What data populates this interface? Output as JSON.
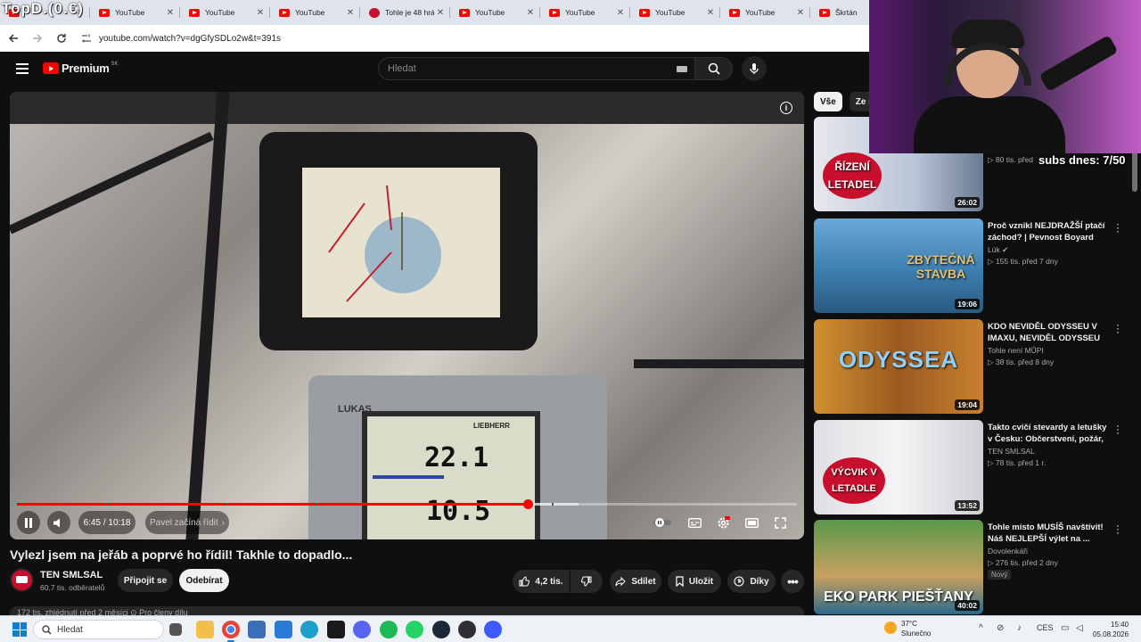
{
  "browser": {
    "overlay_logo": "TopD.(0.€)",
    "tabs": [
      {
        "title": "",
        "icon": "youtube-icon"
      },
      {
        "title": "YouTube",
        "icon": "youtube-icon"
      },
      {
        "title": "YouTube",
        "icon": "youtube-icon"
      },
      {
        "title": "YouTube",
        "icon": "youtube-icon"
      },
      {
        "title": "Tohle je 48 hrá",
        "icon": "site-icon"
      },
      {
        "title": "YouTube",
        "icon": "youtube-icon"
      },
      {
        "title": "YouTube",
        "icon": "youtube-icon"
      },
      {
        "title": "YouTube",
        "icon": "youtube-icon"
      },
      {
        "title": "YouTube",
        "icon": "youtube-icon"
      },
      {
        "title": "Škrtán",
        "icon": "youtube-icon"
      }
    ],
    "url": "youtube.com/watch?v=dgGfySDLo2w&t=391s"
  },
  "header": {
    "logo_text": "Premium",
    "logo_country": "SK",
    "search_placeholder": "Hledat"
  },
  "player": {
    "time": "6:45 / 10:18",
    "chapter": "Pavel začíná řídit",
    "played_fraction": 0.655,
    "loaded_fraction": 0.72,
    "lcd_top": "22.1",
    "lcd_bottom": "10.5",
    "brand_label": "LIEBHERR",
    "panel_label": "LUKAS"
  },
  "video": {
    "title": "Vylezl jsem na jeřáb a poprvé ho řídil! Takhle to dopadlo...",
    "channel": "TEN SMLSAL",
    "subscribers": "60,7 tis. odběratelů",
    "join_label": "Připojit se",
    "subscribe_label": "Odebírat",
    "likes": "4,2 tis.",
    "share_label": "Sdílet",
    "save_label": "Uložit",
    "thanks_label": "Díky",
    "description_peek": "172 tis. zhlédnutí  před 2 měsíci  ⊙ Pro členy dílu"
  },
  "sidebar": {
    "chips": [
      "Vše",
      "Ze s"
    ],
    "recommendations": [
      {
        "title": "",
        "channel": "",
        "meta": "▷ 80 tis.  před",
        "duration": "26:02",
        "caption": "ŘÍZENÍ LETADEL",
        "badge": ""
      },
      {
        "title": "Proč vznikl NEJDRAŽŠÍ ptačí záchod? | Pevnost Boyard",
        "channel": "Lúk ✔",
        "meta": "▷ 155 tis.  před 7 dny",
        "duration": "19:06",
        "caption": "ZBYTEČNÁ STAVBA",
        "badge": ""
      },
      {
        "title": "KDO NEVIDĚL ODYSSEU V IMAXU, NEVIDĚL ODYSSEU 💀",
        "channel": "Tohle není MŮPI",
        "meta": "▷ 38 tis.  před 8 dny",
        "duration": "19:04",
        "caption": "ODYSSEA",
        "badge": ""
      },
      {
        "title": "Takto cvičí stevardy a letušky v Česku: Občerstvení, požár, skl...",
        "channel": "TEN SMLSAL",
        "meta": "▷ 78 tis.  před 1 r.",
        "duration": "13:52",
        "caption": "VÝCVIK V LETADLE",
        "badge": ""
      },
      {
        "title": "Tohle místo MUSÍŠ navštívit! Náš NEJLEPŠÍ výlet na ...",
        "channel": "Dovolenkáři",
        "meta": "▷ 276 tis.  před 2 dny",
        "duration": "40:02",
        "caption": "EKO PARK PIEŠŤANY",
        "badge": "Nový"
      }
    ]
  },
  "stream": {
    "subs_counter": "subs dnes: 7/50"
  },
  "taskbar": {
    "search_placeholder": "Hledat",
    "weather_temp": "37°C",
    "weather_text": "Slunečno",
    "language": "CES",
    "time": "15:40",
    "date": "05.08.2026"
  },
  "colors": {
    "accent": "#ff0000",
    "background": "#0f0f0f",
    "surface": "#272727"
  }
}
